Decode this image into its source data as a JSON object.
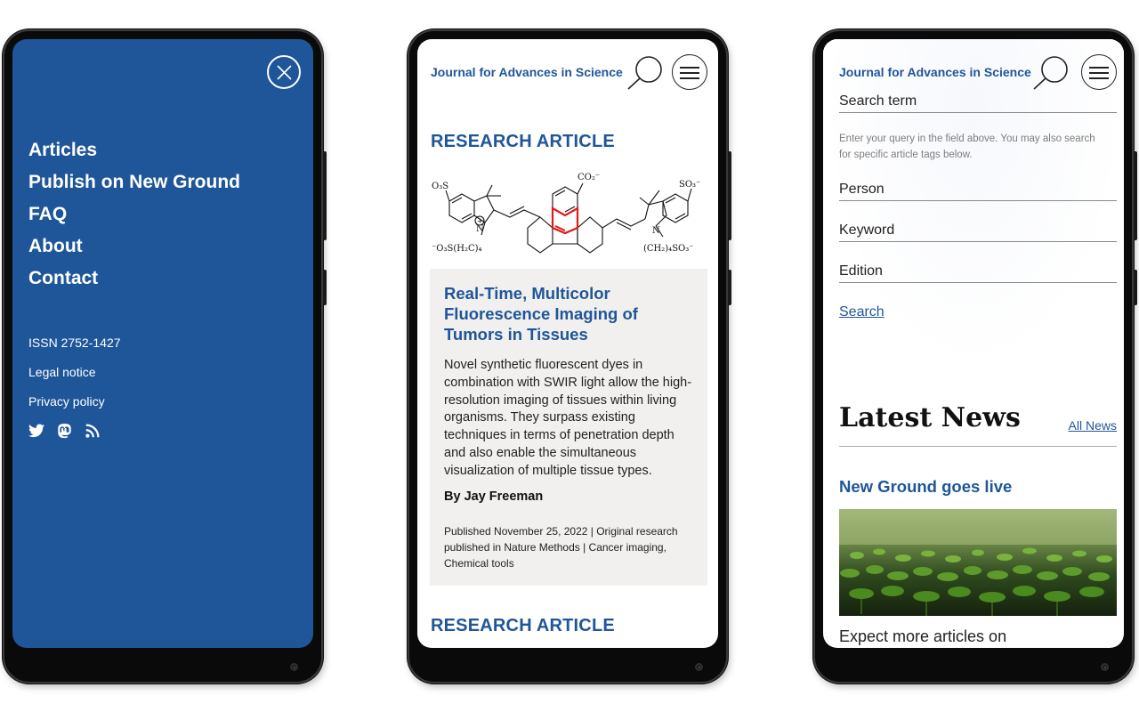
{
  "colors": {
    "brand_blue": "#1f5699",
    "card_bg": "#f1f0ef",
    "phone_frame": "#0a0a0a"
  },
  "menu_screen": {
    "close_icon": "close-circle-icon",
    "nav_items": [
      "Articles",
      "Publish on New Ground",
      "FAQ",
      "About",
      "Contact"
    ],
    "meta_items": [
      "ISSN 2752-1427",
      "Legal notice",
      "Privacy policy"
    ],
    "social_icons": [
      "twitter-icon",
      "mastodon-icon",
      "rss-icon"
    ]
  },
  "article_screen": {
    "site_title": "Journal for Advances in Science",
    "section_label": "RESEARCH ARTICLE",
    "molecule_labels": {
      "top_left": "O₃S",
      "top_center": "CO₂⁻",
      "top_right": "SO₃⁻",
      "bottom_left": "⁻O₃S(H₂C)₄",
      "bottom_right": "(CH₂)₄SO₃⁻",
      "n_left": "N",
      "n_right": "N",
      "plus": "+"
    },
    "card": {
      "title": "Real-Time, Multicolor Fluorescence Imaging of Tumors in Tissues",
      "text": "Novel synthetic fluorescent dyes in combination with SWIR light allow the high-resolution imaging of tissues within living organisms. They surpass existing techniques in terms of penetration depth and also enable the simultaneous visualization of multiple tissue types.",
      "author": "By Jay Freeman",
      "meta": "Published November 25, 2022 | Original research published in Nature Methods | Cancer imaging, Chemical tools"
    },
    "next_section_label": "RESEARCH ARTICLE"
  },
  "search_screen": {
    "site_title": "Journal for Advances in Science",
    "search_term_label": "Search term",
    "help_text": "Enter your query in the field above. You may also search for specific article tags below.",
    "fields": [
      "Person",
      "Keyword",
      "Edition"
    ],
    "search_label": "Search",
    "news_heading": "Latest News",
    "all_news_label": "All News",
    "news_title": "New Ground goes live",
    "news_excerpt": "Expect more articles on"
  }
}
